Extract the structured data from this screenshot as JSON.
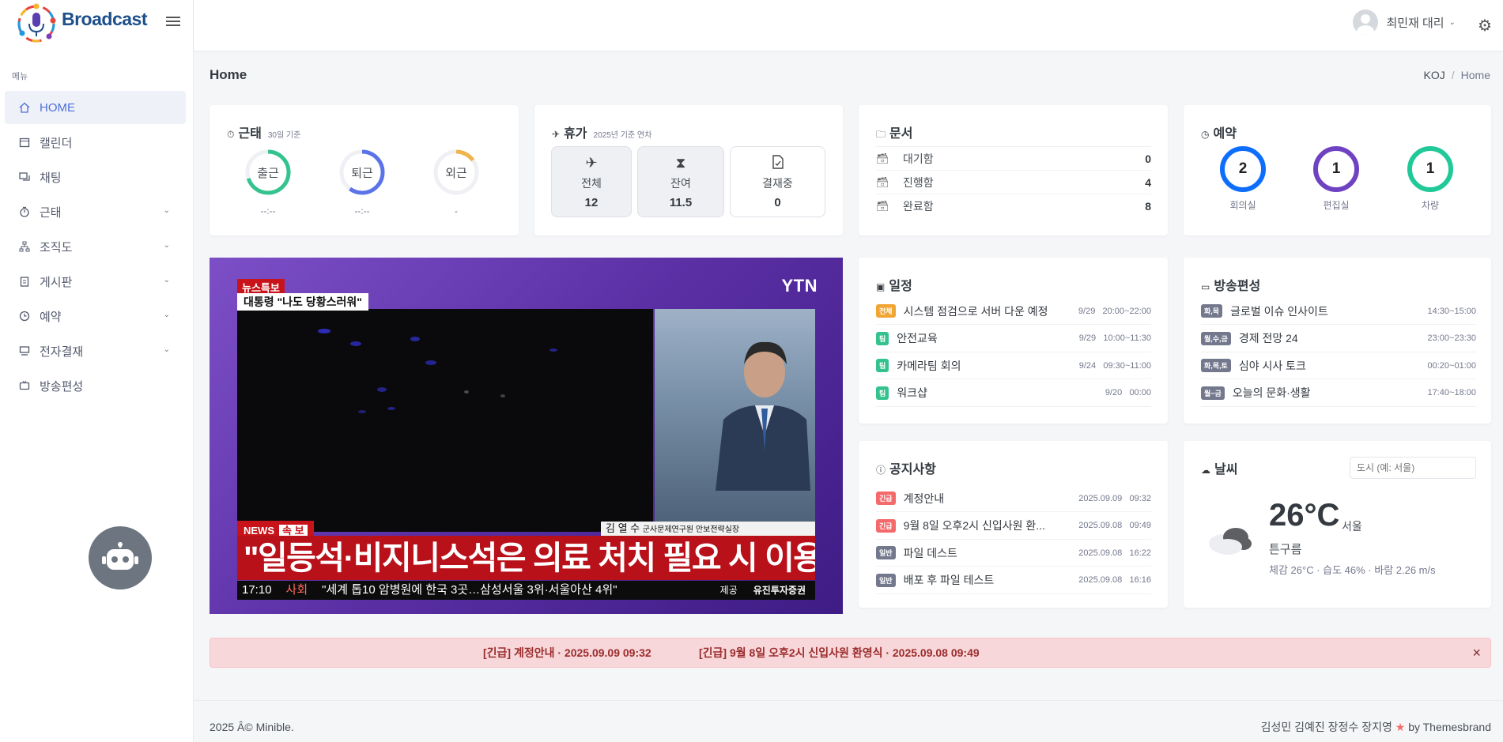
{
  "app": {
    "name": "Broadcast"
  },
  "sidebar": {
    "menu_title": "메뉴",
    "items": [
      {
        "label": "HOME",
        "icon": "home-icon",
        "active": true,
        "has_children": false
      },
      {
        "label": "캘린더",
        "icon": "calendar-icon",
        "active": false,
        "has_children": false
      },
      {
        "label": "채팅",
        "icon": "chat-icon",
        "active": false,
        "has_children": false
      },
      {
        "label": "근태",
        "icon": "timer-icon",
        "active": false,
        "has_children": true
      },
      {
        "label": "조직도",
        "icon": "sitemap-icon",
        "active": false,
        "has_children": true
      },
      {
        "label": "게시판",
        "icon": "clipboard-icon",
        "active": false,
        "has_children": true
      },
      {
        "label": "예약",
        "icon": "clock-icon",
        "active": false,
        "has_children": true
      },
      {
        "label": "전자결재",
        "icon": "desk-icon",
        "active": false,
        "has_children": true
      },
      {
        "label": "방송편성",
        "icon": "tv-icon",
        "active": false,
        "has_children": false
      }
    ]
  },
  "topbar": {
    "user_name": "최민재 대리"
  },
  "page": {
    "title": "Home",
    "breadcrumb": [
      "KOJ",
      "Home"
    ]
  },
  "attendance": {
    "title": "근태",
    "subtitle": "30일 기준",
    "items": [
      {
        "label": "출근",
        "value": "--:--",
        "color": "#34c38f",
        "fill": 0.7
      },
      {
        "label": "퇴근",
        "value": "--:--",
        "color": "#5b73e8",
        "fill": 0.6
      },
      {
        "label": "외근",
        "value": "-",
        "color": "#f1b44c",
        "fill": 0.15
      }
    ]
  },
  "vacation": {
    "title": "휴가",
    "subtitle": "2025년 기준 연차",
    "items": [
      {
        "label": "전체",
        "value": "12",
        "icon": "airplane-icon"
      },
      {
        "label": "잔여",
        "value": "11.5",
        "icon": "hourglass-icon"
      },
      {
        "label": "결재중",
        "value": "0",
        "icon": "file-check-icon"
      }
    ]
  },
  "documents": {
    "title": "문서",
    "items": [
      {
        "label": "대기함",
        "value": "0"
      },
      {
        "label": "진행함",
        "value": "4"
      },
      {
        "label": "완료함",
        "value": "8"
      }
    ]
  },
  "reservation": {
    "title": "예약",
    "items": [
      {
        "label": "회의실",
        "value": "2",
        "color": "#0d6efd"
      },
      {
        "label": "편집실",
        "value": "1",
        "color": "#6f42c1"
      },
      {
        "label": "차량",
        "value": "1",
        "color": "#20c997"
      }
    ]
  },
  "video": {
    "channel": "YTN",
    "tag": "뉴스특보",
    "subtitle": "대통령 \"나도 당황스러워\"",
    "news_label": "NEWS",
    "flash_label": "속 보",
    "name_bar": "김 열 수",
    "name_role": "군사문제연구원 안보전략실장",
    "headline": "\"일등석·비지니스석은 의료 처치 필요 시 이용\"",
    "time": "17:10",
    "category": "사회",
    "ticker": "\"세계 톱10 암병원에 한국 3곳…삼성서울 3위·서울아산 4위\"",
    "sponsor_label": "제공",
    "sponsor": "유진투자증권"
  },
  "schedule": {
    "title": "일정",
    "items": [
      {
        "badge": "전체",
        "badge_color": "#f1a533",
        "title": "시스템 점검으로 서버 다운 예정",
        "date": "9/29",
        "time": "20:00~22:00"
      },
      {
        "badge": "팀",
        "badge_color": "#34c38f",
        "title": "안전교육",
        "date": "9/29",
        "time": "10:00~11:30"
      },
      {
        "badge": "팀",
        "badge_color": "#34c38f",
        "title": "카메라팀 회의",
        "date": "9/24",
        "time": "09:30~11:00"
      },
      {
        "badge": "팀",
        "badge_color": "#34c38f",
        "title": "워크샵",
        "date": "9/20",
        "time": "00:00"
      }
    ]
  },
  "broadcast": {
    "title": "방송편성",
    "items": [
      {
        "badge": "화,목",
        "title": "글로벌 이슈 인사이트",
        "time": "14:30~15:00"
      },
      {
        "badge": "월,수,금",
        "title": "경제 전망 24",
        "time": "23:00~23:30"
      },
      {
        "badge": "화,목,토",
        "title": "심야 시사 토크",
        "time": "00:20~01:00"
      },
      {
        "badge": "월~금",
        "title": "오늘의 문화·생활",
        "time": "17:40~18:00"
      }
    ]
  },
  "notices": {
    "title": "공지사항",
    "items": [
      {
        "badge": "긴급",
        "badge_color": "#f46a6a",
        "title": "계정안내",
        "date": "2025.09.09",
        "time": "09:32"
      },
      {
        "badge": "긴급",
        "badge_color": "#f46a6a",
        "title": "9월 8일 오후2시 신입사원 환...",
        "date": "2025.09.08",
        "time": "09:49"
      },
      {
        "badge": "일반",
        "badge_color": "#74788d",
        "title": "파일 데스트",
        "date": "2025.09.08",
        "time": "16:22"
      },
      {
        "badge": "일반",
        "badge_color": "#74788d",
        "title": "배포 후 파일 테스트",
        "date": "2025.09.08",
        "time": "16:16"
      }
    ]
  },
  "weather": {
    "title": "날씨",
    "placeholder": "도시 (예: 서울)",
    "temp": "26°C",
    "city": "서울",
    "condition": "튼구름",
    "details": "체감 26°C · 습도 46% · 바람 2.26 m/s"
  },
  "alert": {
    "items": [
      "[긴급] 계정안내 · 2025.09.09 09:32",
      "[긴급] 9월 8일 오후2시 신입사원 환영식 · 2025.09.08 09:49"
    ],
    "close": "×"
  },
  "footer": {
    "left": "2025 Â© Minible.",
    "right_names": "김성민 김예진 장정수 장지영",
    "right_suffix": "by Themesbrand"
  }
}
